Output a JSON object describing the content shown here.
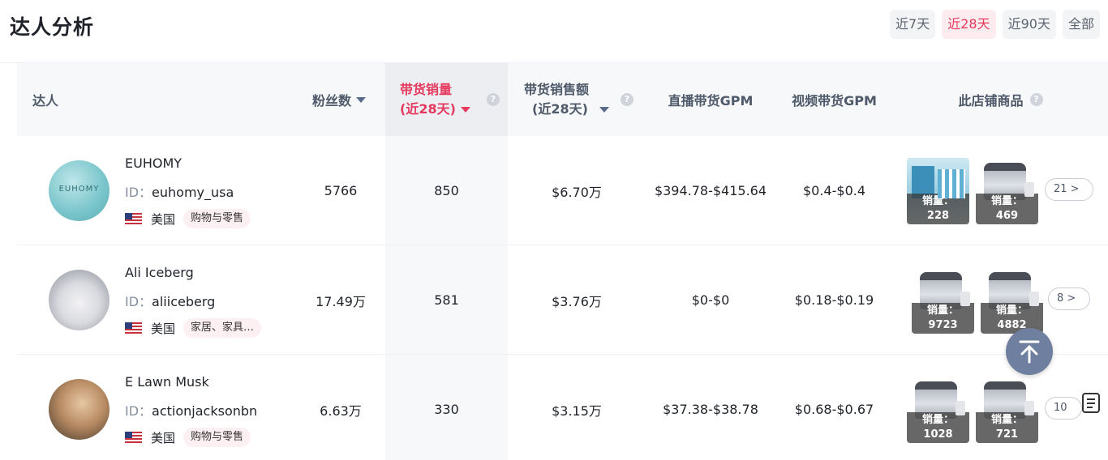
{
  "page": {
    "title": "达人分析"
  },
  "range_tabs": [
    {
      "label": "近7天",
      "active": false
    },
    {
      "label": "近28天",
      "active": true
    },
    {
      "label": "近90天",
      "active": false
    },
    {
      "label": "全部",
      "active": false
    }
  ],
  "columns": {
    "creator": "达人",
    "followers": "粉丝数",
    "sales_line1": "带货销量",
    "sales_line2": "(近28天)",
    "revenue_line1": "带货销售额",
    "revenue_line2": "(近28天)",
    "live_gpm": "直播带货GPM",
    "video_gpm": "视频带货GPM",
    "store_products": "此店铺商品"
  },
  "help_icon_glyph": "?",
  "rows": [
    {
      "name": "EUHOMY",
      "id_label": "ID：",
      "id": "euhomy_usa",
      "country": "美国",
      "category": "购物与零售",
      "followers": "5766",
      "sales": "850",
      "revenue": "$6.70万",
      "live_gpm": "$394.78-$415.64",
      "video_gpm": "$0.4-$0.4",
      "avatar_text": "EUHOMY",
      "products": [
        {
          "sales_label": "销量：",
          "sales": "228",
          "image": "product-box"
        },
        {
          "sales_label": "销量：",
          "sales": "469",
          "image": "ice-maker"
        }
      ],
      "more": "21 >"
    },
    {
      "name": "Ali Iceberg",
      "id_label": "ID：",
      "id": "aliiceberg",
      "country": "美国",
      "category": "家居、家具…",
      "followers": "17.49万",
      "sales": "581",
      "revenue": "$3.76万",
      "live_gpm": "$0-$0",
      "video_gpm": "$0.18-$0.19",
      "products": [
        {
          "sales_label": "销量：",
          "sales": "9723",
          "image": "ice-maker"
        },
        {
          "sales_label": "销量：",
          "sales": "4882",
          "image": "ice-maker"
        }
      ],
      "more": "8 >"
    },
    {
      "name": "E Lawn Musk",
      "id_label": "ID：",
      "id": "actionjacksonbn",
      "country": "美国",
      "category": "购物与零售",
      "followers": "6.63万",
      "sales": "330",
      "revenue": "$3.15万",
      "live_gpm": "$37.38-$38.78",
      "video_gpm": "$0.68-$0.67",
      "products": [
        {
          "sales_label": "销量：",
          "sales": "1028",
          "image": "ice-maker"
        },
        {
          "sales_label": "销量：",
          "sales": "721",
          "image": "ice-maker"
        }
      ],
      "more": "10"
    }
  ],
  "colors": {
    "accent": "#e5395e",
    "header_bg": "#f7f8fa",
    "fab": "#6f7f9f"
  }
}
